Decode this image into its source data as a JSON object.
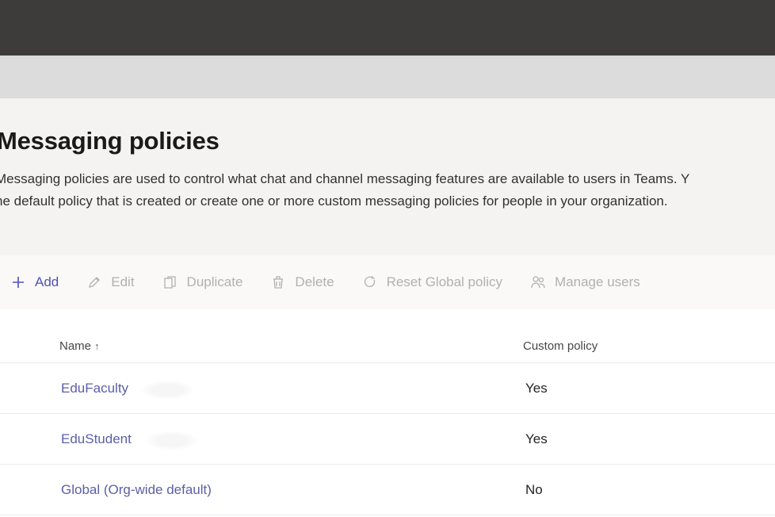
{
  "page": {
    "title": "Messaging policies",
    "description_line1": "Messaging policies are used to control what chat and channel messaging features are available to users in Teams. Y",
    "description_line2": "he default policy that is created or create one or more custom messaging policies for people in your organization."
  },
  "toolbar": {
    "add_label": "Add",
    "edit_label": "Edit",
    "duplicate_label": "Duplicate",
    "delete_label": "Delete",
    "reset_label": "Reset Global policy",
    "manage_label": "Manage users",
    "colors": {
      "active": "#4f52b2",
      "disabled": "#b3b0ad"
    }
  },
  "table": {
    "columns": {
      "name": "Name",
      "custom": "Custom policy"
    },
    "rows": [
      {
        "name": "EduFaculty",
        "custom": "Yes"
      },
      {
        "name": "EduStudent",
        "custom": "Yes"
      },
      {
        "name": "Global (Org-wide default)",
        "custom": "No"
      }
    ]
  }
}
